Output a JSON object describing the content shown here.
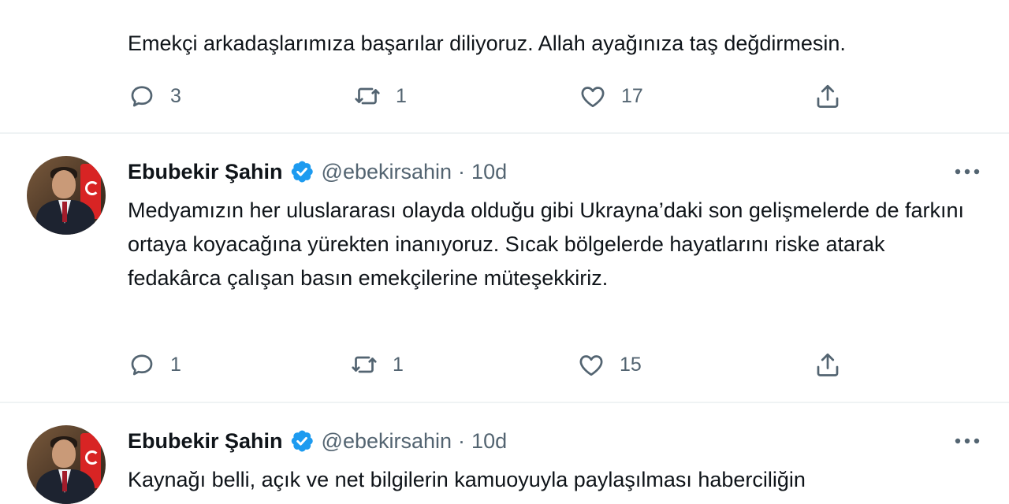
{
  "tweets": [
    {
      "text": "Emekçi arkadaşlarımıza başarılar diliyoruz. Allah ayağınıza taş değdirmesin.",
      "replies": "3",
      "retweets": "1",
      "likes": "17"
    },
    {
      "author": "Ebubekir Şahin",
      "handle": "@ebekirsahin",
      "separator": "·",
      "time": "10d",
      "text": "Medyamızın her uluslararası olayda olduğu gibi Ukrayna’daki son gelişmelerde de farkını ortaya koyacağına yürekten inanıyoruz. Sıcak bölgelerde hayatlarını riske atarak fedakârca çalışan basın emekçilerine müteşekkiriz.",
      "replies": "1",
      "retweets": "1",
      "likes": "15"
    },
    {
      "author": "Ebubekir Şahin",
      "handle": "@ebekirsahin",
      "separator": "·",
      "time": "10d",
      "text": "Kaynağı belli, açık ve net bilgilerin kamuoyuyla paylaşılması haberciliğin"
    }
  ],
  "icons": {
    "reply": "reply-icon",
    "retweet": "retweet-icon",
    "like": "like-icon",
    "share": "share-icon",
    "verified": "verified-badge-icon",
    "more": "more-options-icon"
  },
  "colors": {
    "verified": "#1d9bf0",
    "muted": "#536471",
    "text": "#0f1419",
    "divider": "#eff3f4"
  }
}
